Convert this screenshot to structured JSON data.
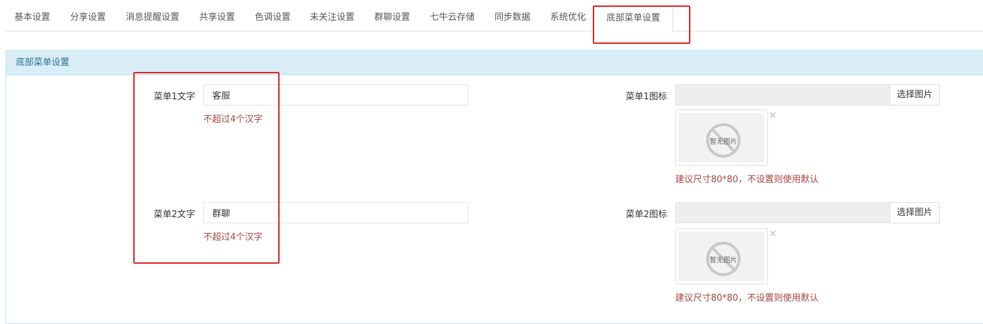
{
  "tabs": [
    {
      "label": "基本设置"
    },
    {
      "label": "分享设置"
    },
    {
      "label": "消息提醒设置"
    },
    {
      "label": "共享设置"
    },
    {
      "label": "色调设置"
    },
    {
      "label": "未关注设置"
    },
    {
      "label": "群聊设置"
    },
    {
      "label": "七牛云存储"
    },
    {
      "label": "同步数据"
    },
    {
      "label": "系统优化"
    },
    {
      "label": "底部菜单设置",
      "active": true
    }
  ],
  "panel": {
    "heading": "底部菜单设置"
  },
  "menus": [
    {
      "text_label": "菜单1文字",
      "text_value": "客服",
      "text_help": "不超过4个汉字",
      "icon_label": "菜单1图标",
      "icon_value": "",
      "pick_button": "选择图片",
      "no_image_text": "暂无图片",
      "close_symbol": "×",
      "icon_help": "建议尺寸80*80，不设置则使用默认"
    },
    {
      "text_label": "菜单2文字",
      "text_value": "群聊",
      "text_help": "不超过4个汉字",
      "icon_label": "菜单2图标",
      "icon_value": "",
      "pick_button": "选择图片",
      "no_image_text": "暂无图片",
      "close_symbol": "×",
      "icon_help": "建议尺寸80*80，不设置则使用默认"
    }
  ],
  "colors": {
    "heading_bg": "#d9edf7",
    "heading_text": "#31708f",
    "help_text": "#a94442",
    "highlight_box": "#e02020"
  },
  "icons": [
    "no-image-icon",
    "close-icon"
  ]
}
